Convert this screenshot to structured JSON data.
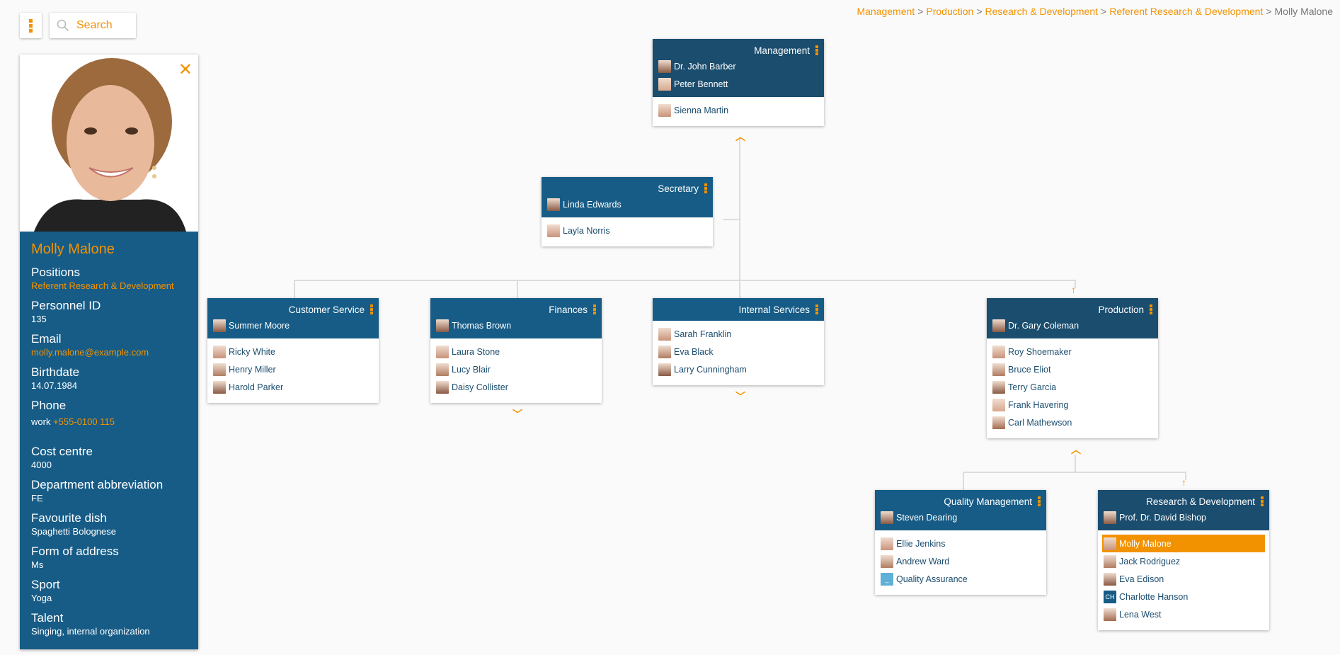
{
  "toolbar": {
    "search_placeholder": "Search"
  },
  "breadcrumb": {
    "items": [
      "Management",
      "Production",
      "Research & Development",
      "Referent Research & Development"
    ],
    "current": "Molly Malone",
    "separator": ">"
  },
  "detail": {
    "name": "Molly Malone",
    "fields": [
      {
        "label": "Positions",
        "value": "Referent Research & Development"
      },
      {
        "label": "Personnel ID",
        "value": "135"
      },
      {
        "label": "Email",
        "value": "molly.malone@example.com"
      },
      {
        "label": "Birthdate",
        "value": "14.07.1984"
      },
      {
        "label": "Phone",
        "prefix": "work",
        "value": "+555-0100 115"
      },
      {
        "label": "Cost centre",
        "value": "4000"
      },
      {
        "label": "Department abbreviation",
        "value": "FE"
      },
      {
        "label": "Favourite dish",
        "value": "Spaghetti Bolognese"
      },
      {
        "label": "Form of address",
        "value": "Ms"
      },
      {
        "label": "Sport",
        "value": "Yoga"
      },
      {
        "label": "Talent",
        "value": "Singing, internal organization"
      }
    ]
  },
  "units": {
    "management": {
      "title": "Management",
      "heads": [
        "Dr. John Barber",
        "Peter Bennett"
      ],
      "members": [
        "Sienna Martin"
      ]
    },
    "secretary": {
      "title": "Secretary",
      "heads": [
        "Linda Edwards"
      ],
      "members": [
        "Layla Norris"
      ]
    },
    "customer_service": {
      "title": "Customer Service",
      "heads": [
        "Summer Moore"
      ],
      "members": [
        "Ricky White",
        "Henry Miller",
        "Harold Parker"
      ]
    },
    "finances": {
      "title": "Finances",
      "heads": [
        "Thomas Brown"
      ],
      "members": [
        "Laura Stone",
        "Lucy Blair",
        "Daisy Collister"
      ]
    },
    "internal_services": {
      "title": "Internal Services",
      "heads": [],
      "members": [
        "Sarah Franklin",
        "Eva Black",
        "Larry Cunningham"
      ]
    },
    "production": {
      "title": "Production",
      "heads": [
        "Dr. Gary Coleman"
      ],
      "members": [
        "Roy Shoemaker",
        "Bruce Eliot",
        "Terry Garcia",
        "Frank Havering",
        "Carl Mathewson"
      ]
    },
    "quality_management": {
      "title": "Quality Management",
      "heads": [
        "Steven Dearing"
      ],
      "members": [
        "Ellie Jenkins",
        "Andrew Ward",
        "Quality Assurance"
      ]
    },
    "research_development": {
      "title": "Research & Development",
      "heads": [
        "Prof. Dr. David Bishop"
      ],
      "members": [
        "Molly Malone",
        "Jack Rodriguez",
        "Eva Edison",
        "Charlotte Hanson",
        "Lena West"
      ],
      "selected": "Molly Malone",
      "initials": {
        "Charlotte Hanson": "CH"
      }
    }
  },
  "colors": {
    "accent": "#f39200",
    "header": "#175c86",
    "header_active_path": "#1b4d6e",
    "member_text": "#1b4d6e",
    "connector": "#dcdcdc",
    "background": "#fafafa"
  }
}
